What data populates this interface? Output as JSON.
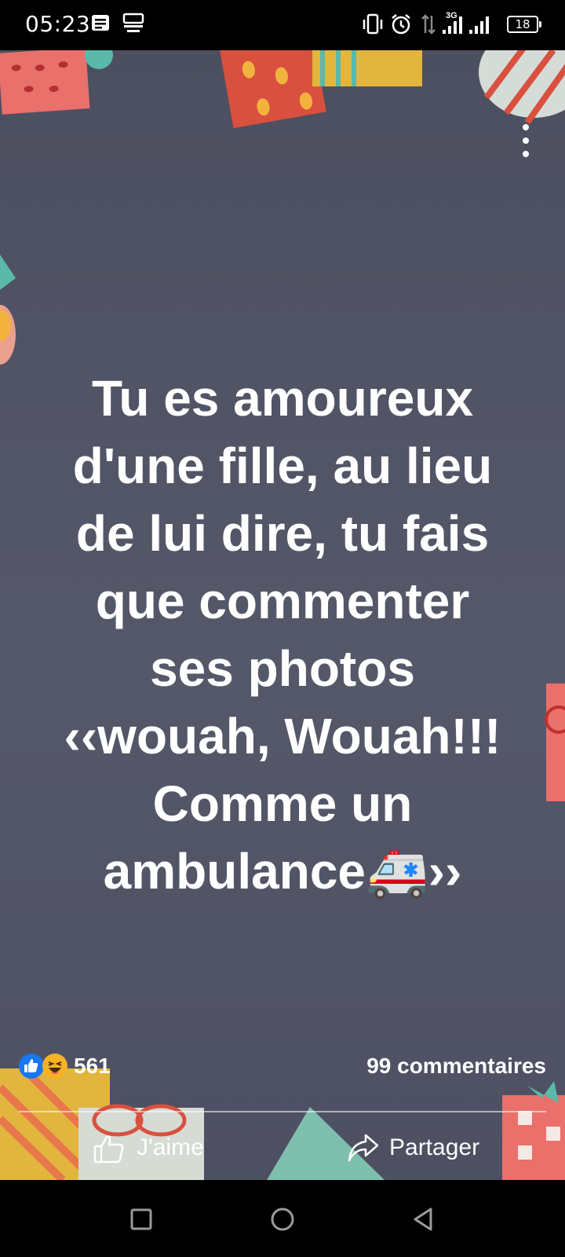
{
  "status_bar": {
    "time": "05:23",
    "battery": "18",
    "network": "3G",
    "icons": [
      "message-icon",
      "notification-icon",
      "vibrate-icon",
      "alarm-icon",
      "data-transfer-icon",
      "signal-icon",
      "signal-icon",
      "battery-icon"
    ]
  },
  "post": {
    "text": "Tu es amoureux\nd'une fille, au lieu\nde lui dire, tu fais\nque  commenter\nses photos\n‹‹wouah, Wouah!!!\nComme un\nambulance🚑››",
    "reactions": {
      "icons": [
        "like-icon",
        "haha-icon"
      ],
      "count": "561"
    },
    "comments": "99 commentaires",
    "actions": {
      "like": "J'aime",
      "share": "Partager"
    },
    "colors": {
      "background": "#505364",
      "like_blue": "#1877f2",
      "haha_yellow": "#f7b125"
    }
  },
  "nav_bar": {
    "buttons": [
      "recents-icon",
      "home-icon",
      "back-icon"
    ]
  }
}
